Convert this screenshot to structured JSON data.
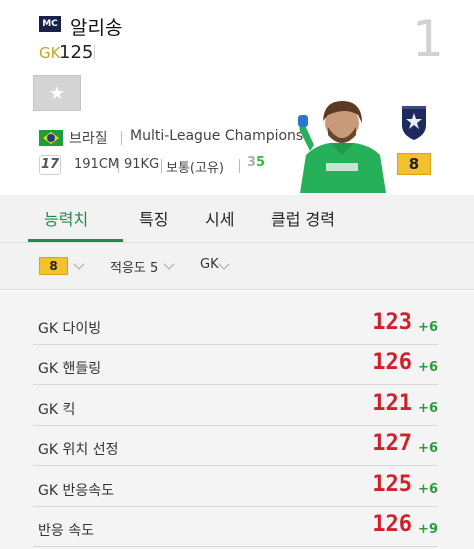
{
  "player": {
    "season_badge": "MC",
    "name": "알리송",
    "position": "GK",
    "overall": "125",
    "rank": "1",
    "nation": "브라질",
    "league": "Multi-League Champions",
    "age": "17",
    "height": "191CM",
    "weight": "91KG",
    "body_type": "보통(고유)",
    "foot_left": "3",
    "foot_right": "5",
    "enhance_level": "8"
  },
  "favorite_button": {
    "icon": "star-icon"
  },
  "colors": {
    "accent_green": "#1b8c4d",
    "stat_red": "#d0202a",
    "bonus_green": "#2e9b3e",
    "enhance_gold": "#f2c12e"
  },
  "tabs": [
    {
      "label": "능력치",
      "active": true
    },
    {
      "label": "특징",
      "active": false
    },
    {
      "label": "시세",
      "active": false
    },
    {
      "label": "클럽 경력",
      "active": false
    }
  ],
  "filters": {
    "enhance": "8",
    "adaptability": "적응도 5",
    "position": "GK"
  },
  "stats": [
    {
      "label": "GK 다이빙",
      "value": "123",
      "bonus": "+6"
    },
    {
      "label": "GK 핸들링",
      "value": "126",
      "bonus": "+6"
    },
    {
      "label": "GK 킥",
      "value": "121",
      "bonus": "+6"
    },
    {
      "label": "GK 위치 선정",
      "value": "127",
      "bonus": "+6"
    },
    {
      "label": "GK 반응속도",
      "value": "125",
      "bonus": "+6"
    },
    {
      "label": "반응 속도",
      "value": "126",
      "bonus": "+9"
    }
  ]
}
